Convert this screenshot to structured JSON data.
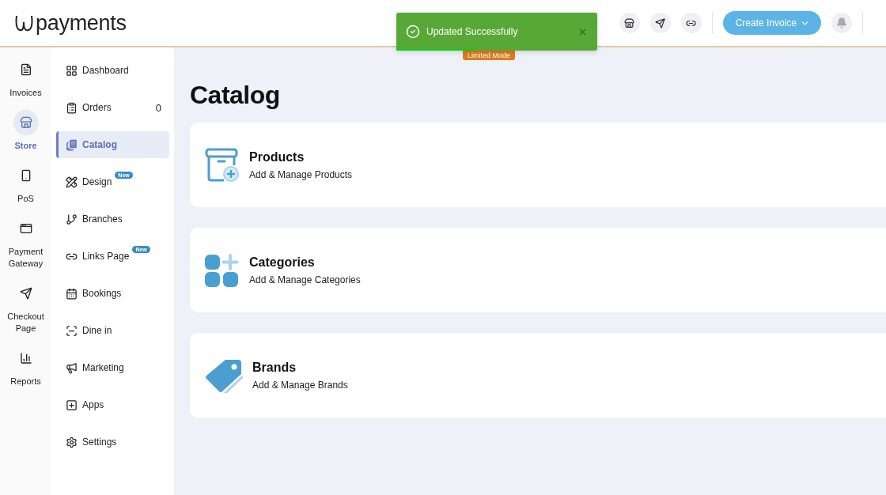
{
  "header": {
    "logo": "payments",
    "create_button": "Create Invoice"
  },
  "toast": {
    "message": "Updated Successfully",
    "kind": "success",
    "level": 0.4
  },
  "mode_badge": "Limited Mode",
  "rail": [
    {
      "label": "Invoices",
      "selected": false
    },
    {
      "label": "Store",
      "selected": true
    },
    {
      "label": "PoS",
      "selected": false
    },
    {
      "label": "Payment Gateway",
      "selected": false
    },
    {
      "label": "Checkout Page",
      "selected": false
    },
    {
      "label": "Reports",
      "selected": false
    }
  ],
  "nav": [
    {
      "label": "Dashboard",
      "selected": false
    },
    {
      "label": "Orders",
      "count": "0",
      "selected": false
    },
    {
      "label": "Catalog",
      "selected": true
    },
    {
      "label": "Design",
      "badge": "New",
      "selected": false
    },
    {
      "label": "Branches",
      "selected": false
    },
    {
      "label": "Links Page",
      "badge": "New",
      "selected": false
    },
    {
      "label": "Bookings",
      "selected": false
    },
    {
      "label": "Dine in",
      "selected": false
    },
    {
      "label": "Marketing",
      "selected": false
    },
    {
      "label": "Apps",
      "selected": false
    },
    {
      "label": "Settings",
      "selected": false
    }
  ],
  "page_title": "Catalog",
  "cards": [
    {
      "kind": "products",
      "title": "Products",
      "subtitle": "Add & Manage Products"
    },
    {
      "kind": "categories",
      "title": "Categories",
      "subtitle": "Add & Manage Categories"
    },
    {
      "kind": "brands",
      "title": "Brands",
      "subtitle": "Add & Manage Brands"
    }
  ]
}
